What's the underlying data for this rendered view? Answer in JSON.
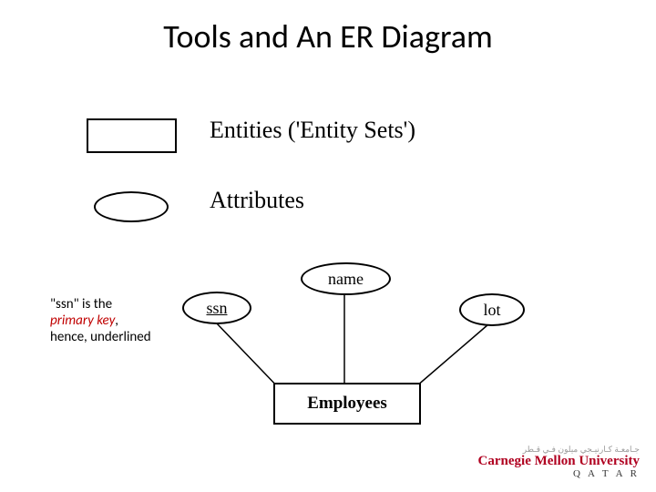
{
  "title": "Tools and An ER Diagram",
  "legend": {
    "entities_label": "Entities ('Entity Sets')",
    "attributes_label": "Attributes"
  },
  "note": {
    "line1": "\"ssn\" is the",
    "line2_pk": "primary key",
    "line2_rest": ",",
    "line3": "hence, underlined"
  },
  "er": {
    "entity": "Employees",
    "attributes": {
      "ssn": "ssn",
      "name": "name",
      "lot": "lot"
    }
  },
  "logo": {
    "top": "جـامعـة كـارنيـجي ميلون فـي قـطر",
    "main": "Carnegie Mellon University",
    "sub": "Q A T A R"
  }
}
